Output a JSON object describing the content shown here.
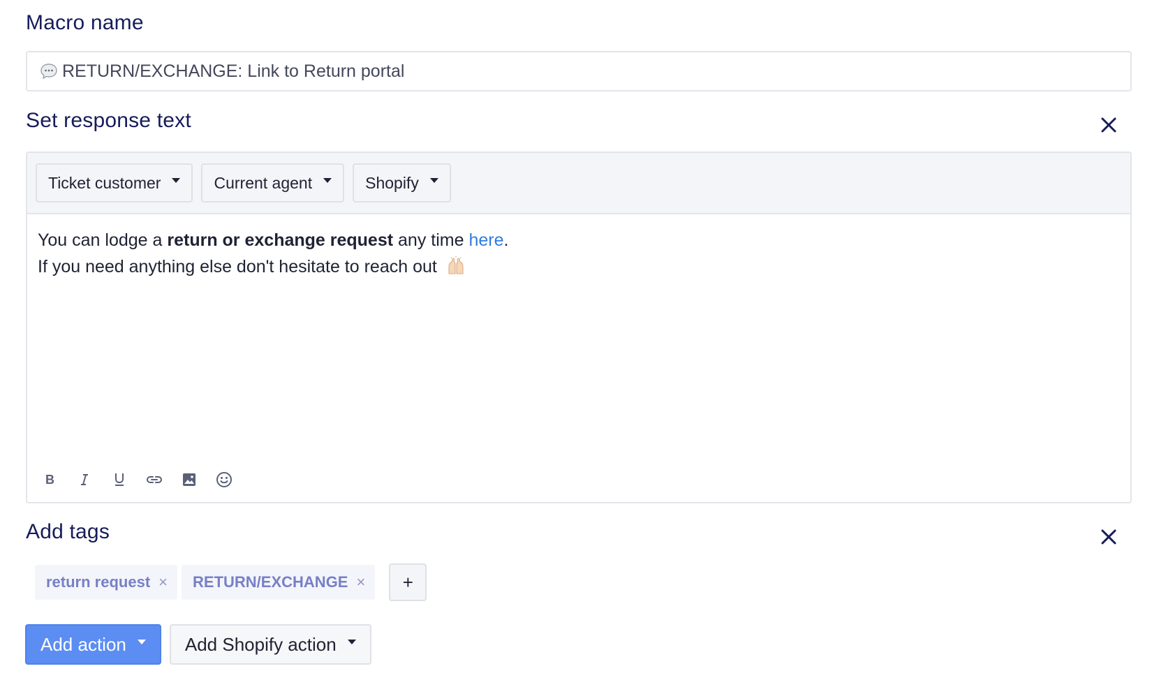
{
  "macro_name": {
    "label": "Macro name",
    "value": "RETURN/EXCHANGE: Link to Return portal",
    "icon": "speech-bubble-icon"
  },
  "response_text": {
    "title": "Set response text",
    "close_icon": "close-icon",
    "variable_buttons": [
      "Ticket customer",
      "Current agent",
      "Shopify"
    ],
    "body": {
      "line1_start": "You can lodge a ",
      "line1_bold": "return or exchange request",
      "line1_mid": " any time ",
      "line1_link": "here",
      "line1_end": ".",
      "line2": "If you need anything else don't hesitate to reach out",
      "line2_emoji": "raising-hands-icon"
    },
    "format_tools": [
      "bold-icon",
      "italic-icon",
      "underline-icon",
      "link-icon",
      "image-icon",
      "emoji-icon"
    ]
  },
  "tags": {
    "title": "Add tags",
    "items": [
      "return request",
      "RETURN/EXCHANGE"
    ],
    "remove_glyph": "×",
    "add_glyph": "+"
  },
  "actions": {
    "add_action": "Add action",
    "add_shopify_action": "Add Shopify action"
  },
  "colors": {
    "heading": "#161c5a",
    "primary": "#5b8df2",
    "link": "#2f7de1",
    "tag_text": "#7680c6"
  }
}
